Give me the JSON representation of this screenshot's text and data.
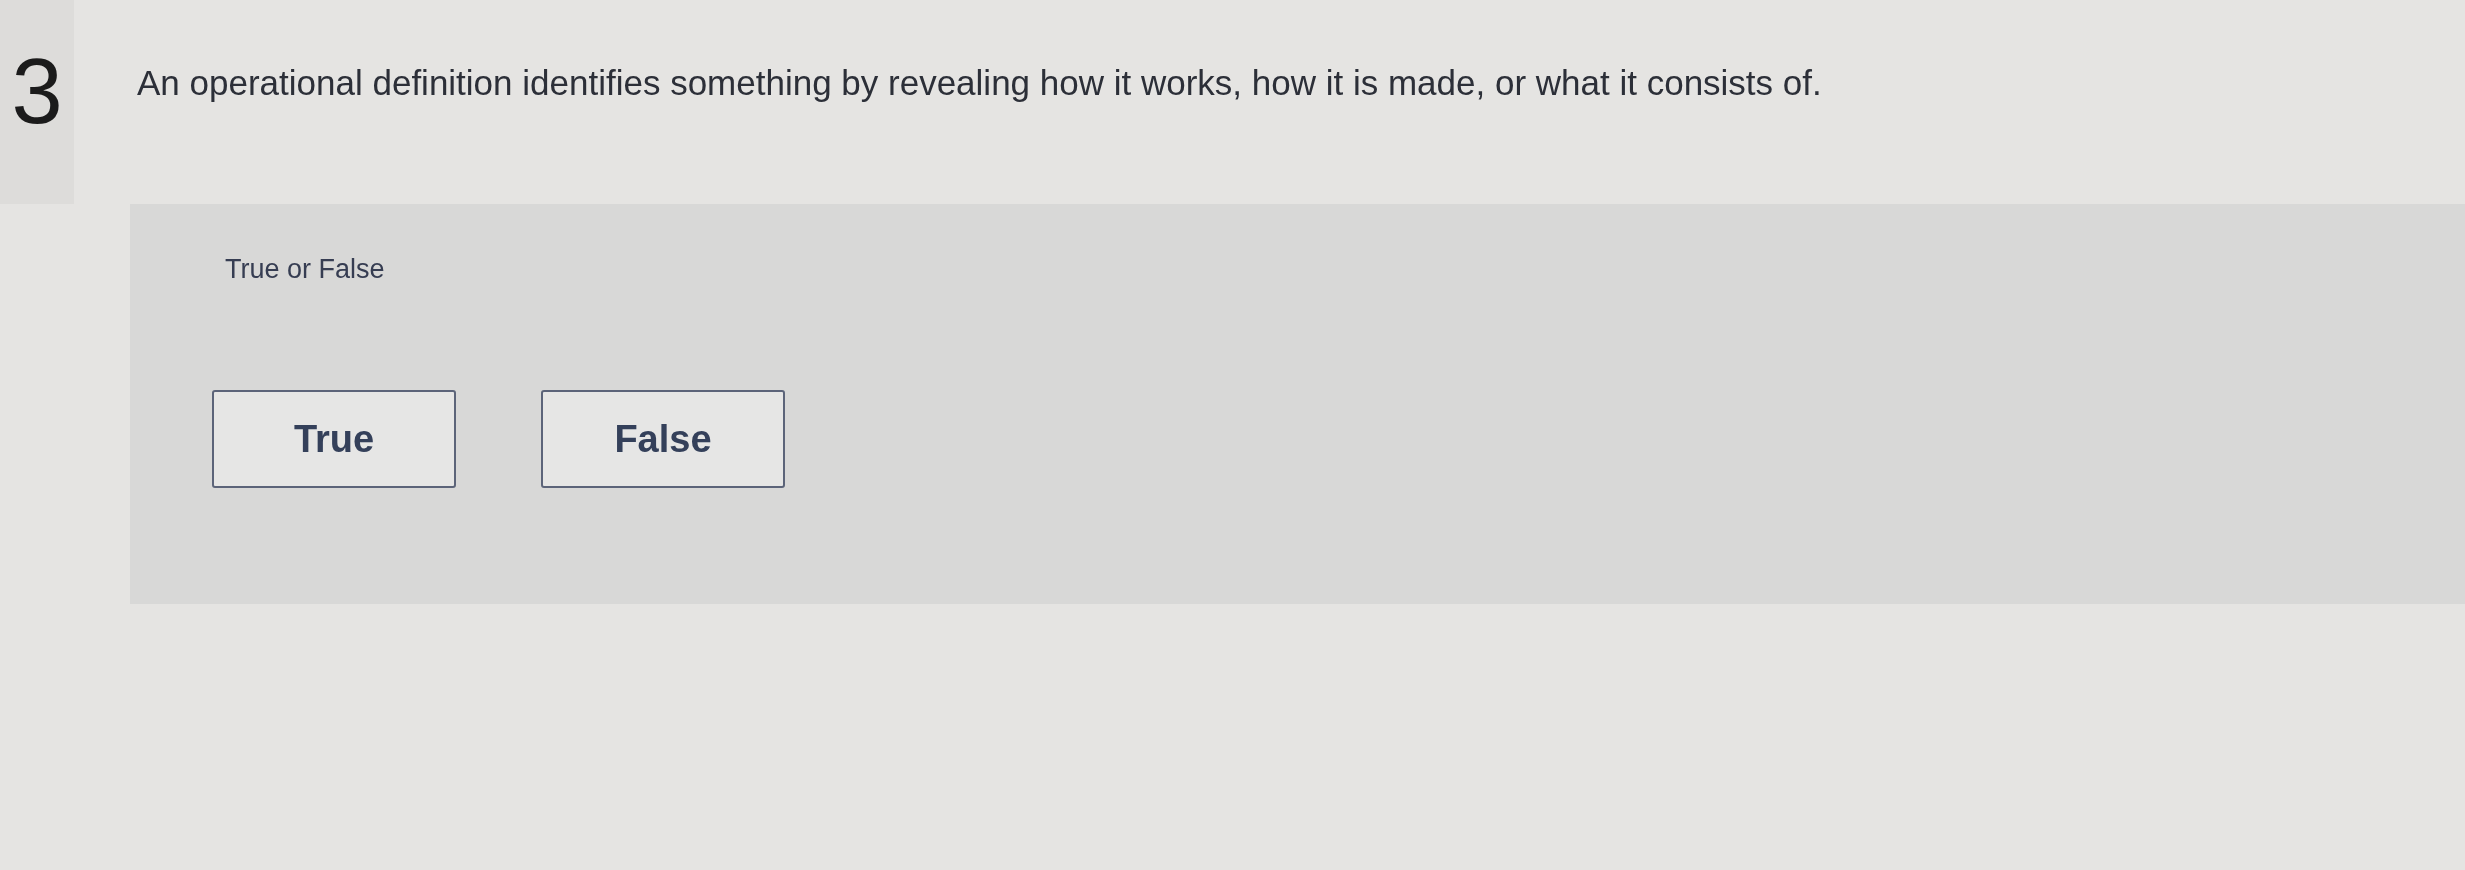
{
  "question": {
    "number": "3",
    "text": "An operational definition identifies something by revealing how it works, how it is made, or what it consists of."
  },
  "answer_panel": {
    "prompt": "True or False",
    "options": [
      {
        "label": "True",
        "selected": false
      },
      {
        "label": "False",
        "selected": false
      }
    ]
  }
}
